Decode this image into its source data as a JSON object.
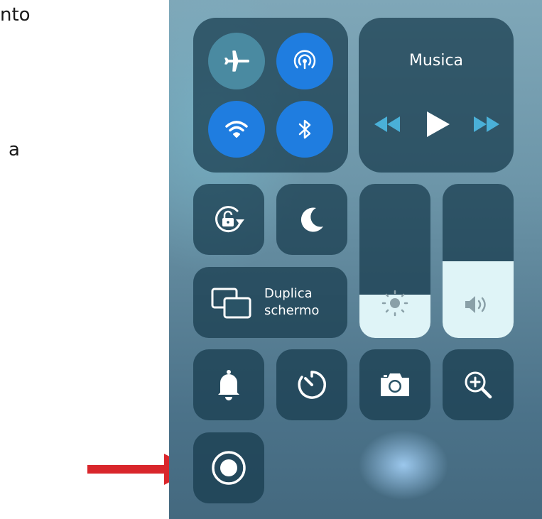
{
  "document": {
    "fragment_1": "nto",
    "fragment_2": "a"
  },
  "control_center": {
    "music": {
      "title": "Musica"
    },
    "screen_mirroring": {
      "line1": "Duplica",
      "line2": "schermo"
    },
    "brightness_level": 0.28,
    "volume_level": 0.5,
    "connectivity": {
      "airplane_mode": "off",
      "hotspot": "on",
      "wifi": "on",
      "bluetooth": "on"
    },
    "icons": [
      "airplane-icon",
      "hotspot-icon",
      "wifi-icon",
      "bluetooth-icon",
      "rewind-icon",
      "play-icon",
      "fast-forward-icon",
      "rotation-lock-icon",
      "moon-icon",
      "screen-mirroring-icon",
      "brightness-icon",
      "speaker-icon",
      "bell-icon",
      "timer-icon",
      "camera-icon",
      "zoom-icon",
      "screen-record-icon"
    ]
  },
  "colors": {
    "active_blue": "#1f7de0",
    "annotation_arrow": "#d9262b",
    "tile_bg": "rgba(22,58,76,0.72)"
  }
}
